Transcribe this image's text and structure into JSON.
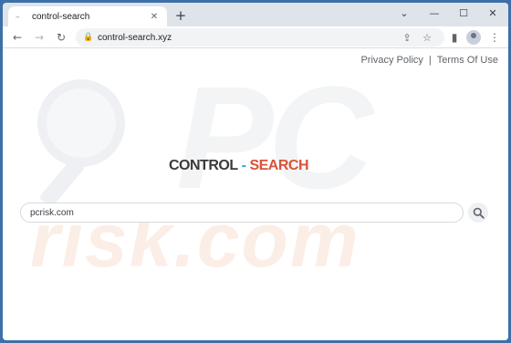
{
  "browser": {
    "tab": {
      "favicon": "--",
      "title": "control-search",
      "close": "✕"
    },
    "new_tab": "+",
    "window_controls": {
      "minimize": "⌄",
      "restore": "—",
      "maximize": "☐",
      "close": "✕"
    },
    "toolbar": {
      "back": "←",
      "forward": "→",
      "reload": "↻",
      "share": "⇪",
      "bookmark": "☆",
      "sidepanel": "▮",
      "menu": "⋮"
    },
    "omnibox": {
      "lock": "🔒",
      "url": "control-search.xyz"
    }
  },
  "page": {
    "legal": {
      "privacy": "Privacy Policy",
      "separator": "|",
      "terms": "Terms Of Use"
    },
    "logo": {
      "part1": "CONTROL",
      "dash": "-",
      "part2": "SEARCH"
    },
    "search": {
      "value": "pcrisk.com"
    },
    "watermark": {
      "pc": "PC",
      "risk": "risk.com"
    }
  },
  "icons": [
    "search-icon",
    "back-icon",
    "forward-icon",
    "reload-icon",
    "lock-icon",
    "share-icon",
    "star-icon",
    "sidepanel-icon",
    "profile-icon",
    "menu-icon",
    "close-icon",
    "plus-icon"
  ],
  "colors": {
    "frame": "#3d6fa8",
    "logo_dark": "#3a3a3a",
    "logo_dash": "#2fa7d6",
    "logo_accent": "#d9533a"
  }
}
